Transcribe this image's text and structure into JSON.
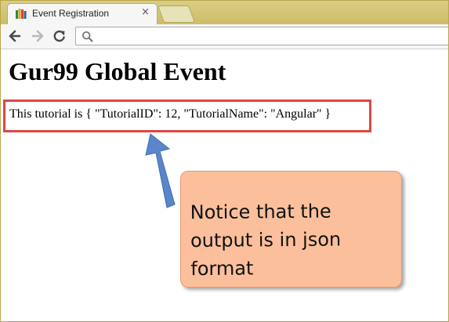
{
  "browser": {
    "tab": {
      "title": "Event Registration",
      "close_glyph": "×",
      "favicon": "bookshelf-icon"
    },
    "toolbar": {
      "back": "back-arrow-icon",
      "forward": "forward-arrow-icon",
      "reload": "reload-icon",
      "address_value": "",
      "search": "search-icon"
    }
  },
  "page": {
    "heading": "Gur99 Global Event",
    "output_text": "This tutorial is { \"TutorialID\": 12, \"TutorialName\": \"Angular\" }"
  },
  "annotation": {
    "callout_text": "Notice that the output is in json format",
    "highlight_color": "#e04545",
    "arrow_color": "#5b86c9",
    "callout_fill": "#fbbf9c"
  }
}
